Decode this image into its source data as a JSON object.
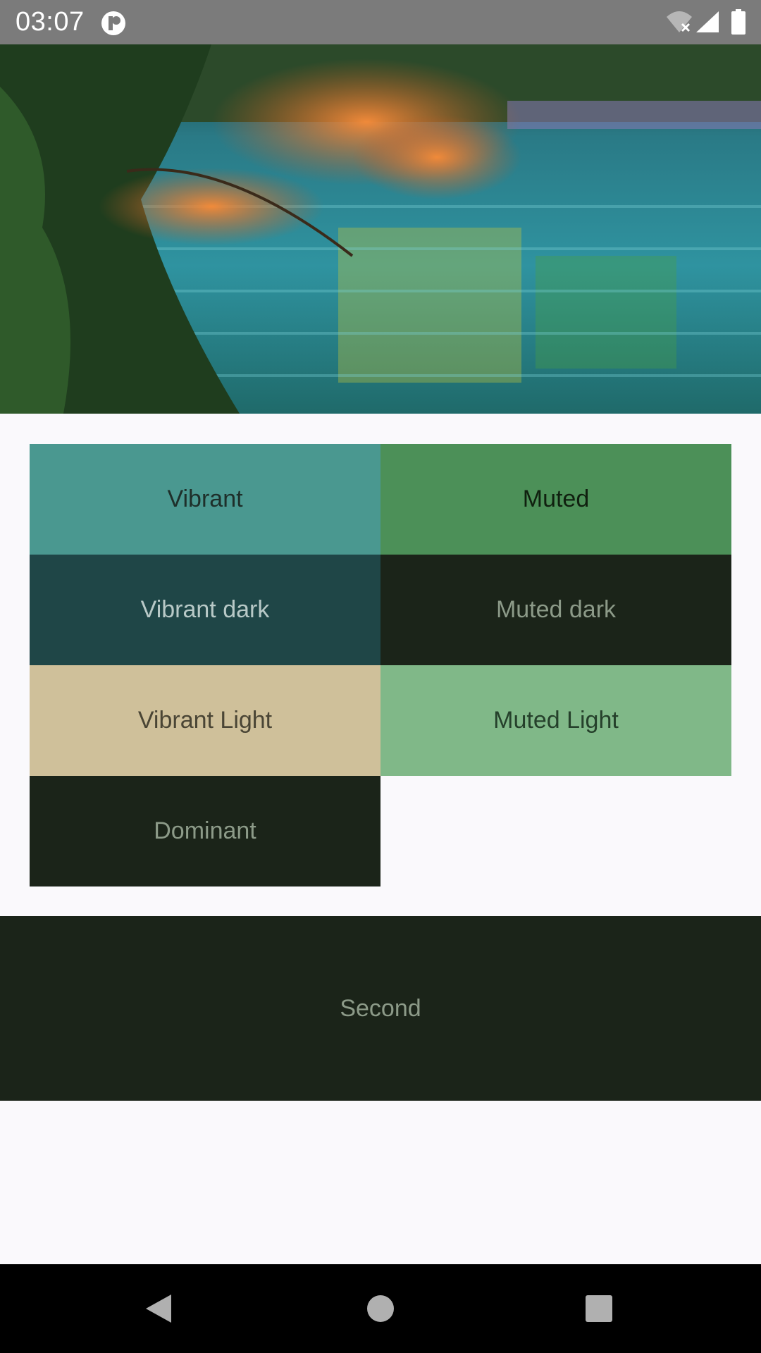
{
  "status_bar": {
    "time": "03:07",
    "background": "#7b7b7b",
    "icons": [
      "app-notification-icon",
      "wifi-off-icon",
      "cell-signal-icon",
      "battery-full-icon"
    ]
  },
  "hero": {
    "description_icon": "landscape-photo",
    "colors": {
      "water": "#2f8a96",
      "leaves": "#e8772f",
      "foliage": "#2f5a2a"
    }
  },
  "swatches": [
    {
      "label": "Vibrant",
      "bg": "#4a9890",
      "fg": "#1e2f2a"
    },
    {
      "label": "Muted",
      "bg": "#4c9058",
      "fg": "#10200f"
    },
    {
      "label": "Vibrant dark",
      "bg": "#1f4647",
      "fg": "#b8c9c7"
    },
    {
      "label": "Muted dark",
      "bg": "#1b2419",
      "fg": "#8c9a88"
    },
    {
      "label": "Vibrant Light",
      "bg": "#cfc09a",
      "fg": "#4a4535"
    },
    {
      "label": "Muted Light",
      "bg": "#80b888",
      "fg": "#25402b"
    },
    {
      "label": "Dominant",
      "bg": "#1b2419",
      "fg": "#8c9a88"
    }
  ],
  "second": {
    "label": "Second",
    "bg": "#1b2419",
    "fg": "#8c9a88"
  },
  "nav": {
    "back": "back-icon",
    "home": "home-icon",
    "recents": "recents-icon"
  }
}
